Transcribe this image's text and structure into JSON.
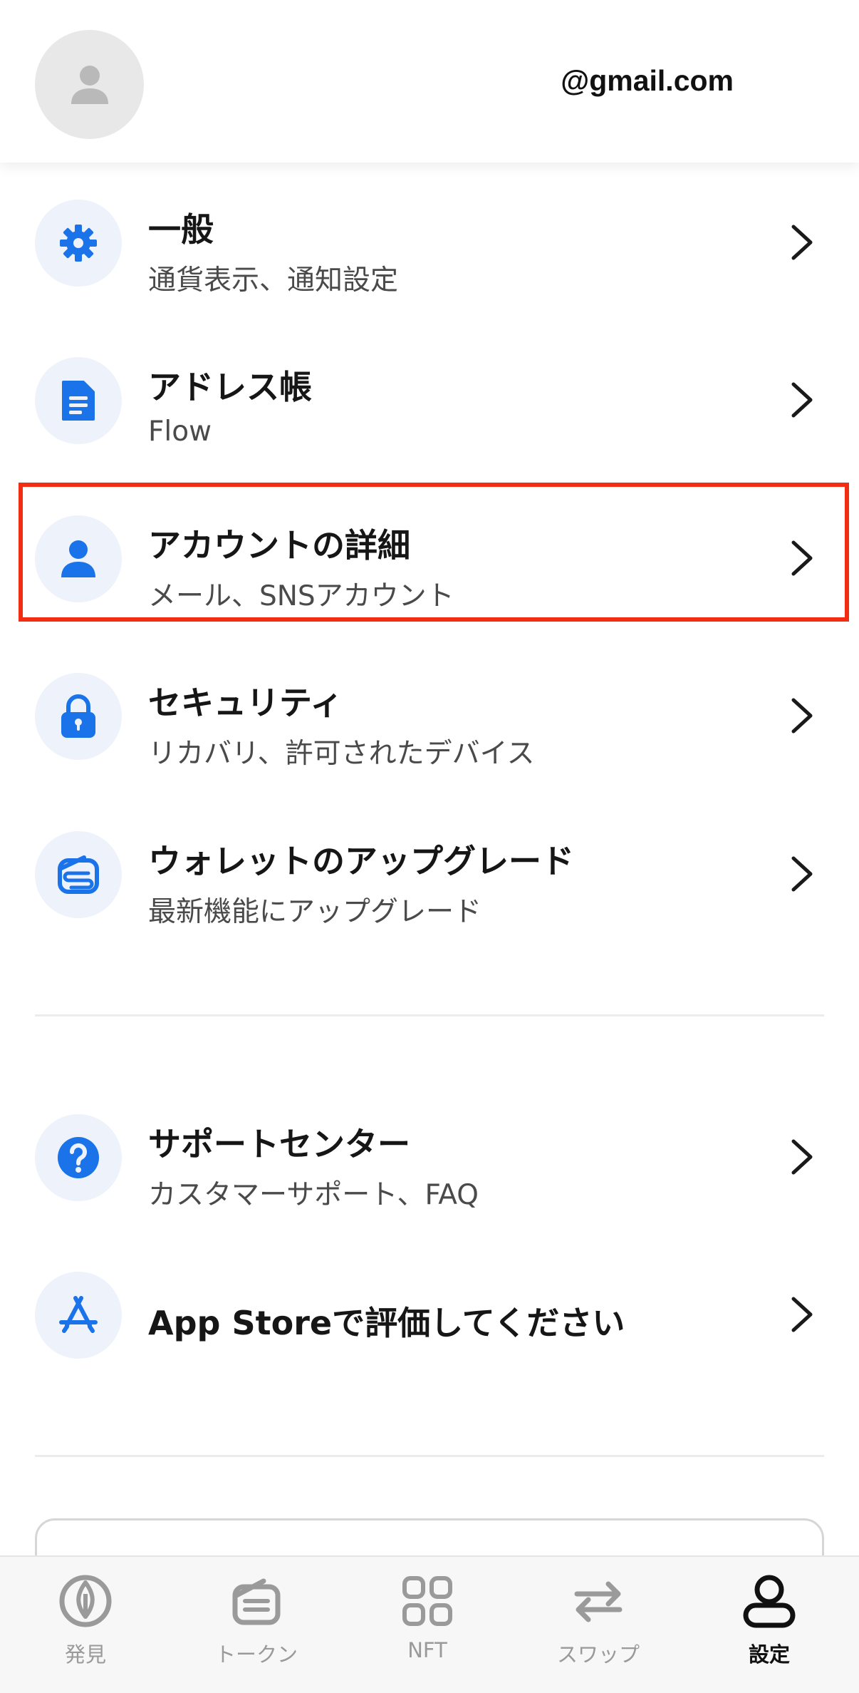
{
  "header": {
    "email": "@gmail.com"
  },
  "menu_primary": [
    {
      "title": "一般",
      "subtitle": "通貨表示、通知設定",
      "icon": "gear-icon"
    },
    {
      "title": "アドレス帳",
      "subtitle": "Flow",
      "icon": "document-icon"
    },
    {
      "title": "アカウントの詳細",
      "subtitle": "メール、SNSアカウント",
      "icon": "person-icon",
      "highlighted": true
    },
    {
      "title": "セキュリティ",
      "subtitle": "リカバリ、許可されたデバイス",
      "icon": "lock-icon"
    },
    {
      "title": "ウォレットのアップグレード",
      "subtitle": "最新機能にアップグレード",
      "icon": "wallet-upgrade-icon"
    }
  ],
  "menu_secondary": [
    {
      "title": "サポートセンター",
      "subtitle": "カスタマーサポート、FAQ",
      "icon": "question-icon"
    },
    {
      "title": "App Storeで評価してください",
      "icon": "app-store-icon"
    }
  ],
  "tabbar": [
    {
      "label": "発見",
      "icon": "discover-icon",
      "active": false
    },
    {
      "label": "トークン",
      "icon": "tokens-icon",
      "active": false
    },
    {
      "label": "NFT",
      "icon": "nft-grid-icon",
      "active": false
    },
    {
      "label": "スワップ",
      "icon": "swap-icon",
      "active": false
    },
    {
      "label": "設定",
      "icon": "profile-icon",
      "active": true
    }
  ],
  "colors": {
    "accent": "#1a73e8",
    "highlight_border": "#f22d12",
    "icon_bg": "#edf2fb",
    "tab_inactive": "#9a9a9a",
    "tab_active": "#111111"
  }
}
